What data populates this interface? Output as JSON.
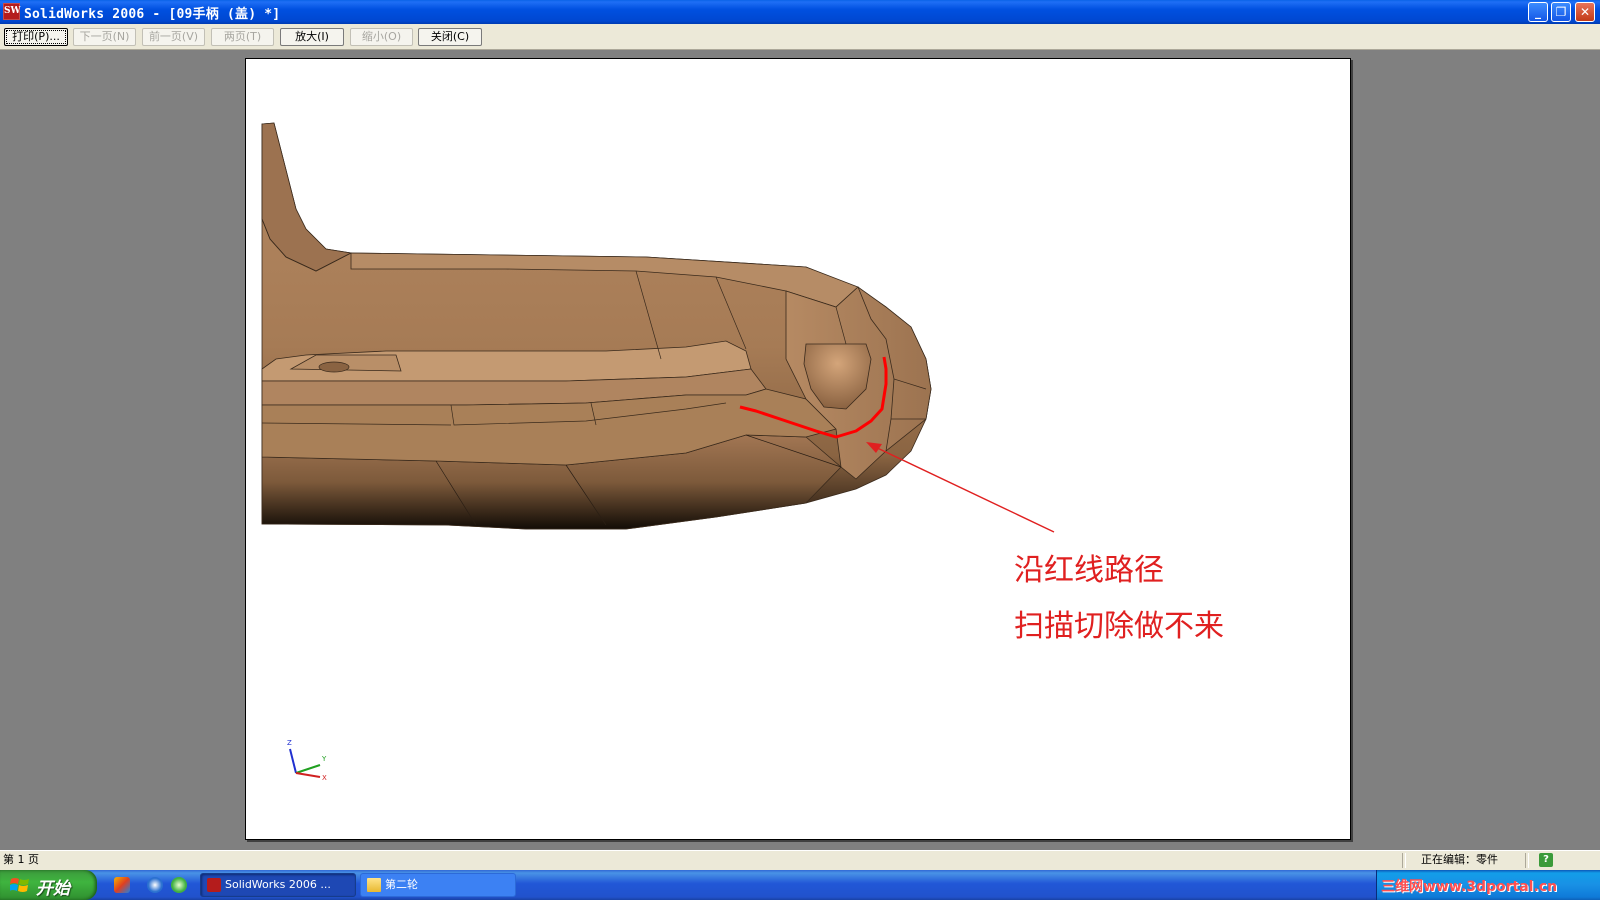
{
  "window": {
    "title": "SolidWorks 2006 - [09手柄 (盖) *]",
    "logo_text": "SW",
    "minimize_glyph": "_",
    "restore_glyph": "❐",
    "close_glyph": "✕"
  },
  "toolbar": {
    "buttons": [
      {
        "label": "打印(P)...",
        "enabled": true
      },
      {
        "label": "下一页(N)",
        "enabled": false
      },
      {
        "label": "前一页(V)",
        "enabled": false
      },
      {
        "label": "两页(T)",
        "enabled": false
      },
      {
        "label": "放大(I)",
        "enabled": true
      },
      {
        "label": "缩小(O)",
        "enabled": false
      },
      {
        "label": "关闭(C)",
        "enabled": true
      }
    ]
  },
  "preview": {
    "annotation_line1": "沿红线路径",
    "annotation_line2": "扫描切除做不来",
    "triad_labels": {
      "z": "Z",
      "y": "Y",
      "x": "X"
    },
    "colors": {
      "model": "#a67b55",
      "path": "#ff0000",
      "annotation": "#e02020"
    }
  },
  "statusbar": {
    "page": "第 1 页",
    "mode": "正在编辑：零件",
    "help_glyph": "?"
  },
  "taskbar": {
    "start_label": "开始",
    "tasks": [
      {
        "label": "SolidWorks 2006 ...",
        "icon": "solidworks-icon",
        "active": true
      },
      {
        "label": "第二轮",
        "icon": "folder-icon",
        "active": false
      }
    ],
    "watermark": "三维网www.3dportal.cn"
  }
}
